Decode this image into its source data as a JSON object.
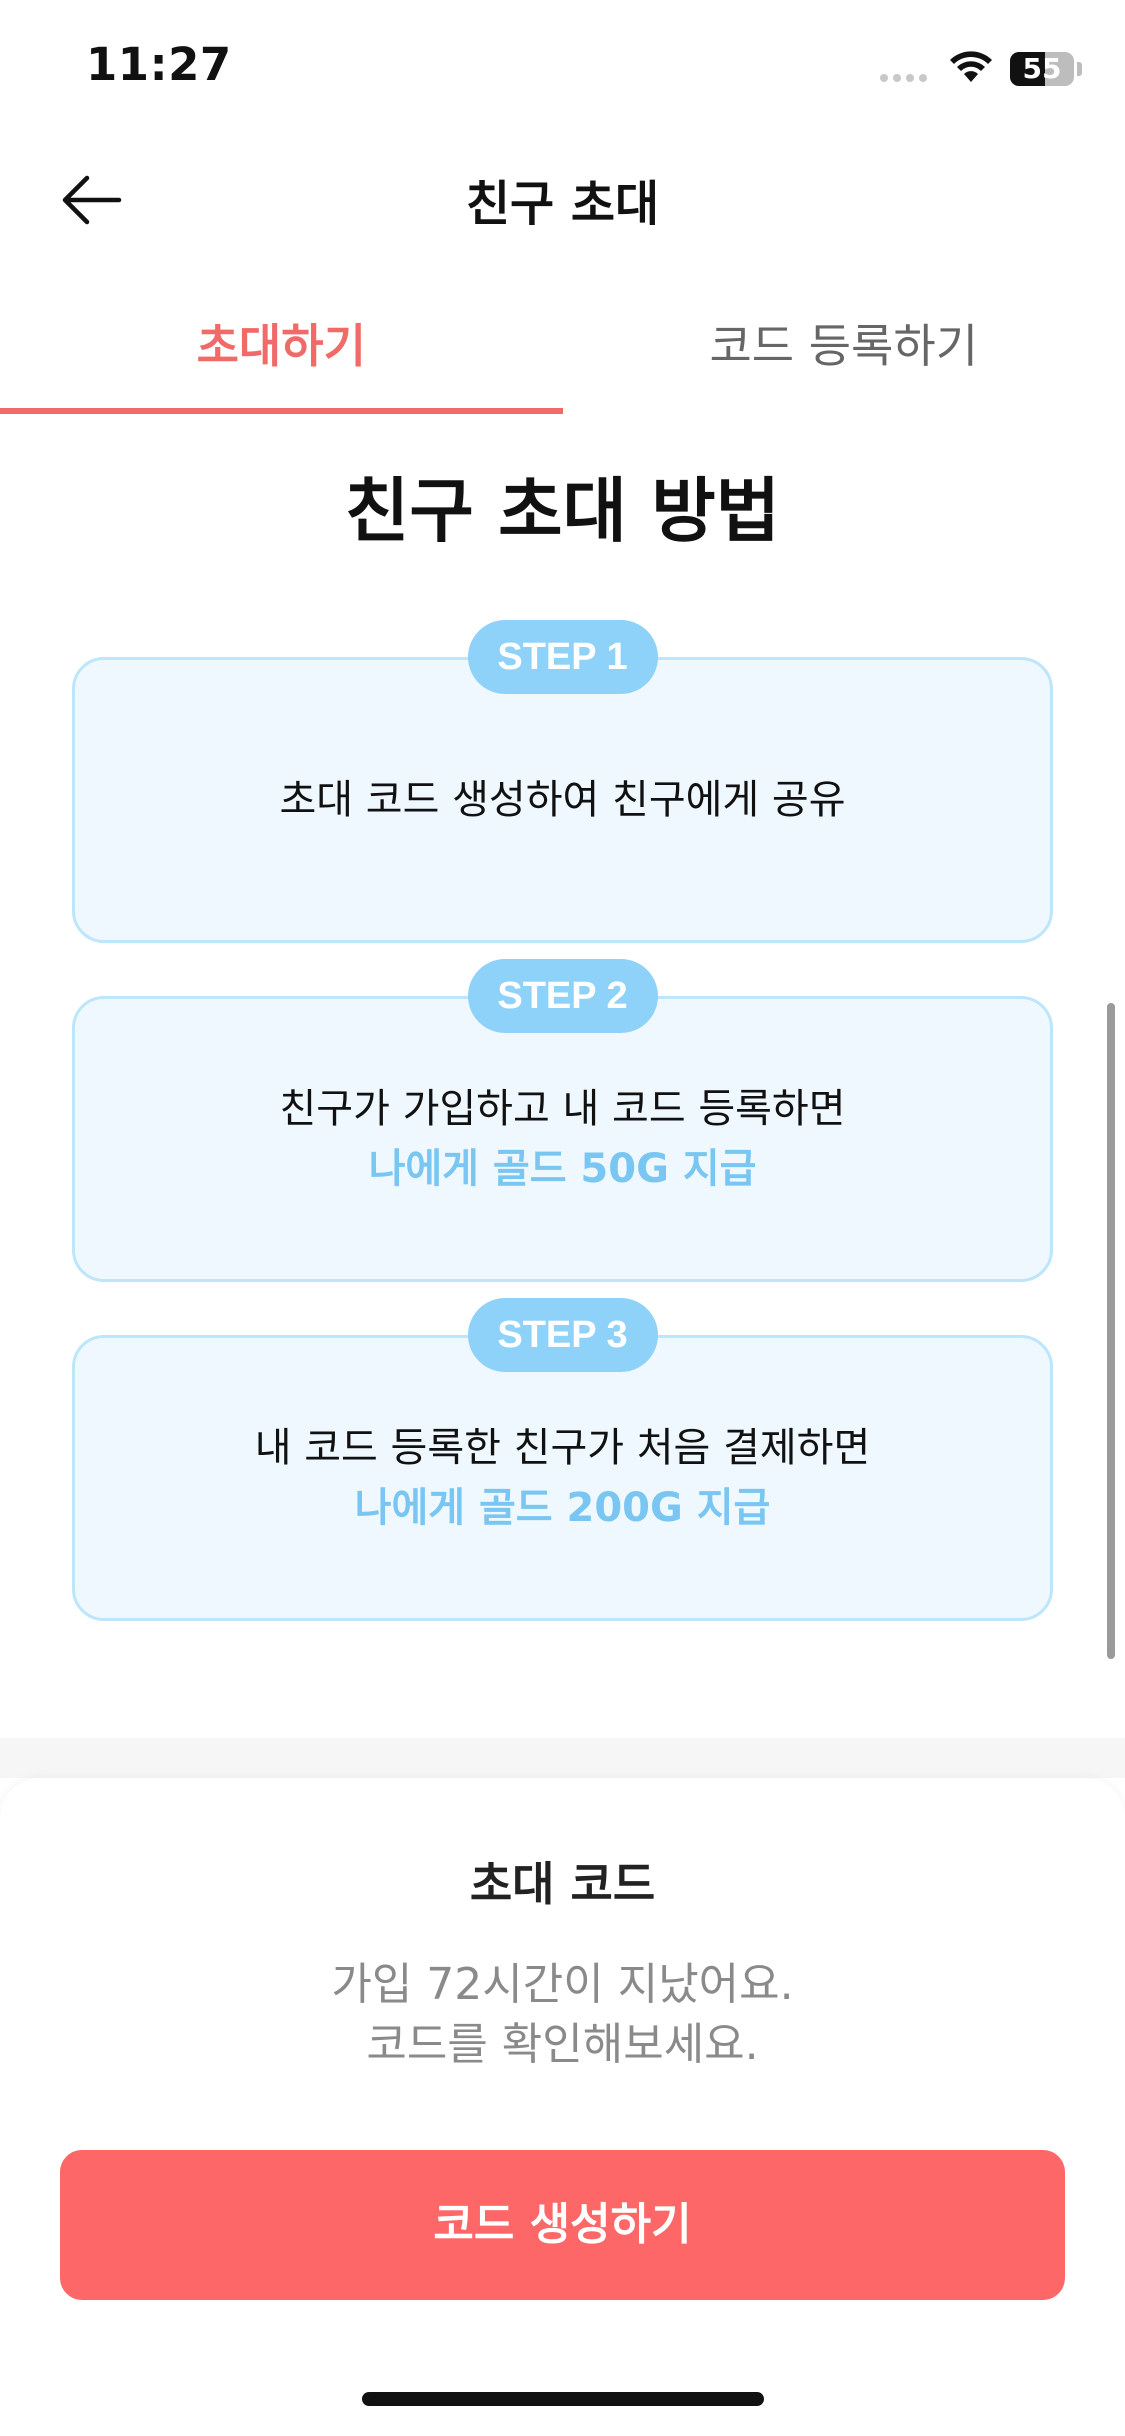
{
  "status_bar": {
    "time": "11:27",
    "battery_level": "55",
    "battery_fraction": 0.55
  },
  "header": {
    "title": "친구 초대",
    "back_icon": "arrow-left-icon"
  },
  "tabs": [
    {
      "label": "초대하기",
      "active": true
    },
    {
      "label": "코드 등록하기",
      "active": false
    }
  ],
  "main": {
    "section_title": "친구 초대 방법",
    "steps": [
      {
        "badge": "STEP 1",
        "text": "초대 코드 생성하여 친구에게 공유",
        "highlight": ""
      },
      {
        "badge": "STEP 2",
        "text": "친구가 가입하고 내 코드 등록하면",
        "highlight": "나에게 골드 50G 지급"
      },
      {
        "badge": "STEP 3",
        "text": "내 코드 등록한 친구가 처음 결제하면",
        "highlight": "나에게 골드 200G 지급"
      }
    ]
  },
  "bottom_sheet": {
    "title": "초대 코드",
    "description_line1": "가입 72시간이 지났어요.",
    "description_line2": "코드를 확인해보세요.",
    "button_label": "코드 생성하기"
  },
  "colors": {
    "accent": "#f16a6a",
    "button": "#fe6767",
    "step_badge": "#8fd2f9",
    "step_highlight": "#78c6f1",
    "card_bg": "#eef8fe"
  }
}
